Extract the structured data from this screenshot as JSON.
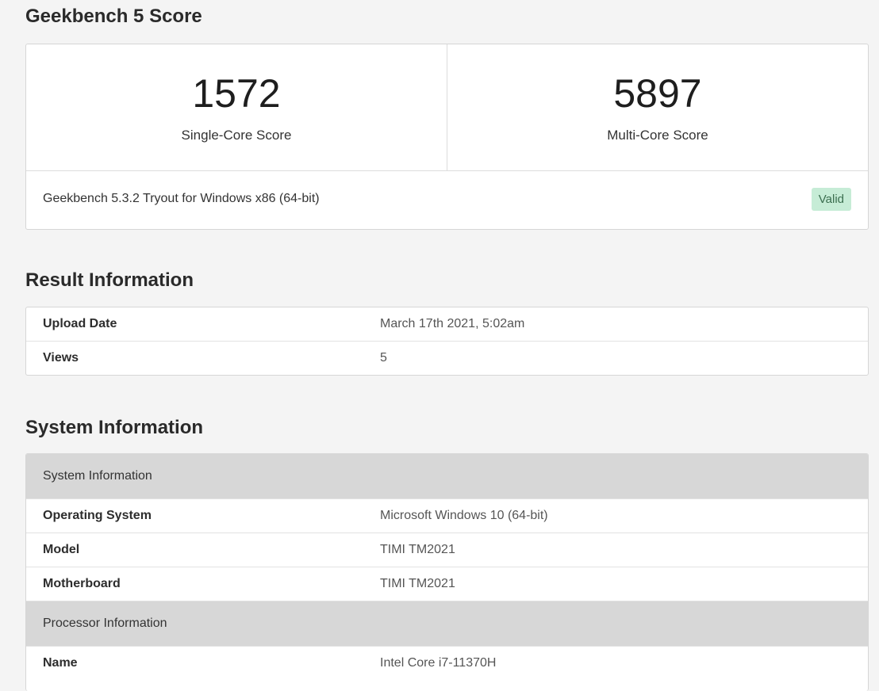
{
  "score": {
    "title": "Geekbench 5 Score",
    "single_core": {
      "value": "1572",
      "label": "Single-Core Score"
    },
    "multi_core": {
      "value": "5897",
      "label": "Multi-Core Score"
    },
    "version": "Geekbench 5.3.2 Tryout for Windows x86 (64-bit)",
    "status_badge": "Valid",
    "status_color": "#c6ecd6"
  },
  "result": {
    "title": "Result Information",
    "rows": [
      {
        "key": "Upload Date",
        "value": "March 17th 2021, 5:02am"
      },
      {
        "key": "Views",
        "value": "5"
      }
    ]
  },
  "system": {
    "title": "System Information",
    "groups": [
      {
        "header": "System Information",
        "rows": [
          {
            "key": "Operating System",
            "value": "Microsoft Windows 10 (64-bit)"
          },
          {
            "key": "Model",
            "value": "TIMI TM2021"
          },
          {
            "key": "Motherboard",
            "value": "TIMI TM2021"
          }
        ]
      },
      {
        "header": "Processor Information",
        "rows": [
          {
            "key": "Name",
            "value": "Intel Core i7-11370H"
          }
        ]
      }
    ]
  }
}
